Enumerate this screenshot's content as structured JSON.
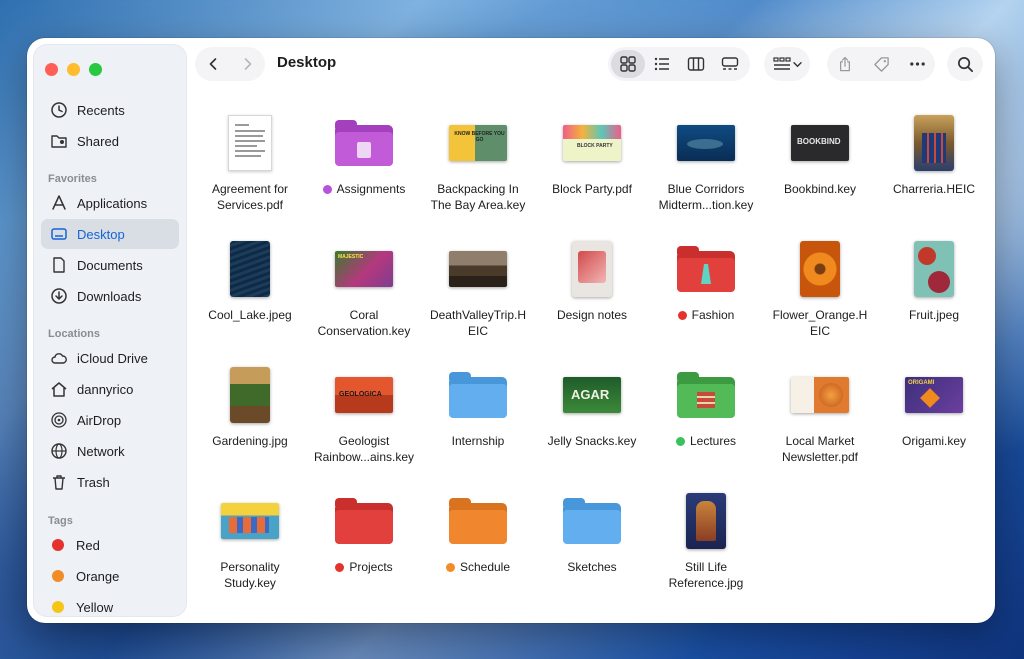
{
  "window": {
    "title": "Desktop"
  },
  "sidebar": {
    "top_items": [
      {
        "label": "Recents",
        "icon": "clock-icon"
      },
      {
        "label": "Shared",
        "icon": "shared-folder-icon"
      }
    ],
    "favorites_header": "Favorites",
    "favorites": [
      {
        "label": "Applications",
        "icon": "applications-icon"
      },
      {
        "label": "Desktop",
        "icon": "desktop-icon",
        "active": true
      },
      {
        "label": "Documents",
        "icon": "document-icon"
      },
      {
        "label": "Downloads",
        "icon": "download-icon"
      }
    ],
    "locations_header": "Locations",
    "locations": [
      {
        "label": "iCloud Drive",
        "icon": "cloud-icon"
      },
      {
        "label": "dannyrico",
        "icon": "home-icon"
      },
      {
        "label": "AirDrop",
        "icon": "airdrop-icon"
      },
      {
        "label": "Network",
        "icon": "globe-icon"
      },
      {
        "label": "Trash",
        "icon": "trash-icon"
      }
    ],
    "tags_header": "Tags",
    "tags": [
      {
        "label": "Red",
        "color": "#e5322d"
      },
      {
        "label": "Orange",
        "color": "#f28c28"
      },
      {
        "label": "Yellow",
        "color": "#f5c518"
      }
    ]
  },
  "toolbar": {
    "view_modes": [
      "icon-view",
      "list-view",
      "column-view",
      "gallery-view"
    ],
    "active_view": "icon-view"
  },
  "files": [
    {
      "line1": "Agreement for",
      "line2": "Services.pdf",
      "kind": "doc"
    },
    {
      "line1": "Assignments",
      "line2": "",
      "kind": "folder",
      "tag": "#b653d9",
      "folder_color": "#b94fd0"
    },
    {
      "line1": "Backpacking In",
      "line2": "The Bay Area.key",
      "kind": "slide"
    },
    {
      "line1": "Block Party.pdf",
      "line2": "",
      "kind": "slide"
    },
    {
      "line1": "Blue Corridors",
      "line2": "Midterm...tion.key",
      "kind": "slide"
    },
    {
      "line1": "Bookbind.key",
      "line2": "",
      "kind": "slide",
      "slide_text": "BOOKBIND"
    },
    {
      "line1": "Charreria.HEIC",
      "line2": "",
      "kind": "photo"
    },
    {
      "line1": "Cool_Lake.jpeg",
      "line2": "",
      "kind": "photo"
    },
    {
      "line1": "Coral",
      "line2": "Conservation.key",
      "kind": "slide"
    },
    {
      "line1": "DeathValleyTrip.H",
      "line2": "EIC",
      "kind": "photo"
    },
    {
      "line1": "Design notes",
      "line2": "",
      "kind": "photo"
    },
    {
      "line1": "Fashion",
      "line2": "",
      "kind": "folder",
      "tag": "#e5322d",
      "folder_color": "#e2403d"
    },
    {
      "line1": "Flower_Orange.H",
      "line2": "EIC",
      "kind": "photo"
    },
    {
      "line1": "Fruit.jpeg",
      "line2": "",
      "kind": "photo"
    },
    {
      "line1": "Gardening.jpg",
      "line2": "",
      "kind": "photo"
    },
    {
      "line1": "Geologist",
      "line2": "Rainbow...ains.key",
      "kind": "slide",
      "slide_text": "GEOLOGICA"
    },
    {
      "line1": "Internship",
      "line2": "",
      "kind": "folder",
      "folder_color": "#5aa9ea"
    },
    {
      "line1": "Jelly Snacks.key",
      "line2": "",
      "kind": "slide",
      "slide_text": "AGAR"
    },
    {
      "line1": "Lectures",
      "line2": "",
      "kind": "folder",
      "tag": "#3cc05a",
      "folder_color": "#4cb552"
    },
    {
      "line1": "Local Market",
      "line2": "Newsletter.pdf",
      "kind": "doc"
    },
    {
      "line1": "Origami.key",
      "line2": "",
      "kind": "slide",
      "slide_text": "ORIGAMI"
    },
    {
      "line1": "Personality",
      "line2": "Study.key",
      "kind": "slide"
    },
    {
      "line1": "Projects",
      "line2": "",
      "kind": "folder",
      "tag": "#e5322d",
      "folder_color": "#e2403d"
    },
    {
      "line1": "Schedule",
      "line2": "",
      "kind": "folder",
      "tag": "#f28c28",
      "folder_color": "#f0862e"
    },
    {
      "line1": "Sketches",
      "line2": "",
      "kind": "folder",
      "folder_color": "#5aa9ea"
    },
    {
      "line1": "Still Life",
      "line2": "Reference.jpg",
      "kind": "photo"
    }
  ]
}
